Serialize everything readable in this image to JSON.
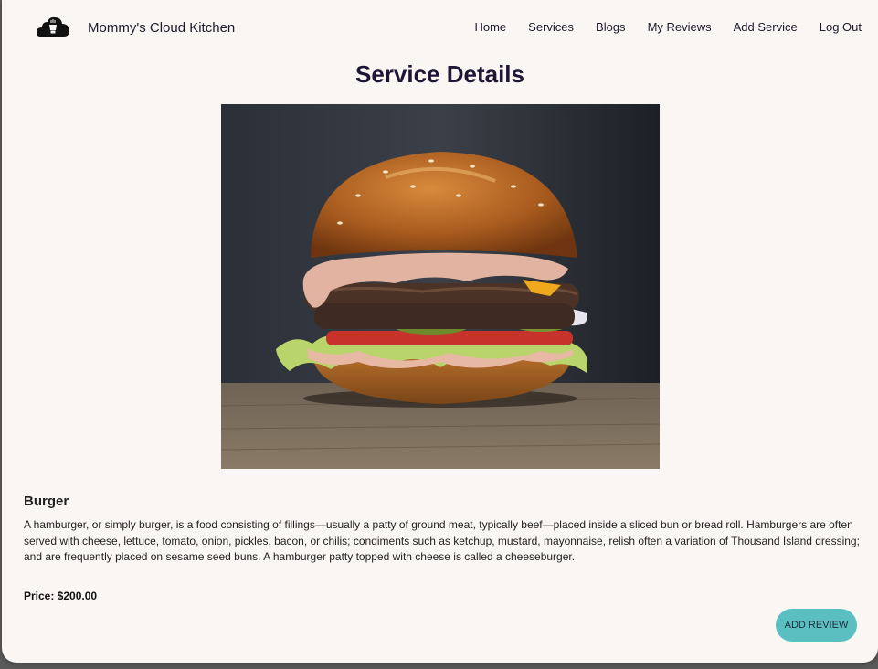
{
  "nav": {
    "brand": "Mommy's Cloud Kitchen",
    "links": [
      "Home",
      "Services",
      "Blogs",
      "My Reviews",
      "Add Service",
      "Log Out"
    ]
  },
  "page": {
    "title": "Service Details"
  },
  "service": {
    "name": "Burger",
    "description": "A hamburger, or simply burger, is a food consisting of fillings—usually a patty of ground meat, typically beef—placed inside a sliced bun or bread roll. Hamburgers are often served with cheese, lettuce, tomato, onion, pickles, bacon, or chilis; condiments such as ketchup, mustard, mayonnaise, relish often a variation of Thousand Island dressing; and are frequently placed on sesame seed buns. A hamburger patty topped with cheese is called a cheeseburger.",
    "price": "Price: $200.00",
    "image_icon": "burger-photo"
  },
  "actions": {
    "add_review": "ADD REVIEW"
  },
  "colors": {
    "background": "#faf6f4",
    "accent": "#5bbfc2",
    "title": "#1f1535"
  }
}
